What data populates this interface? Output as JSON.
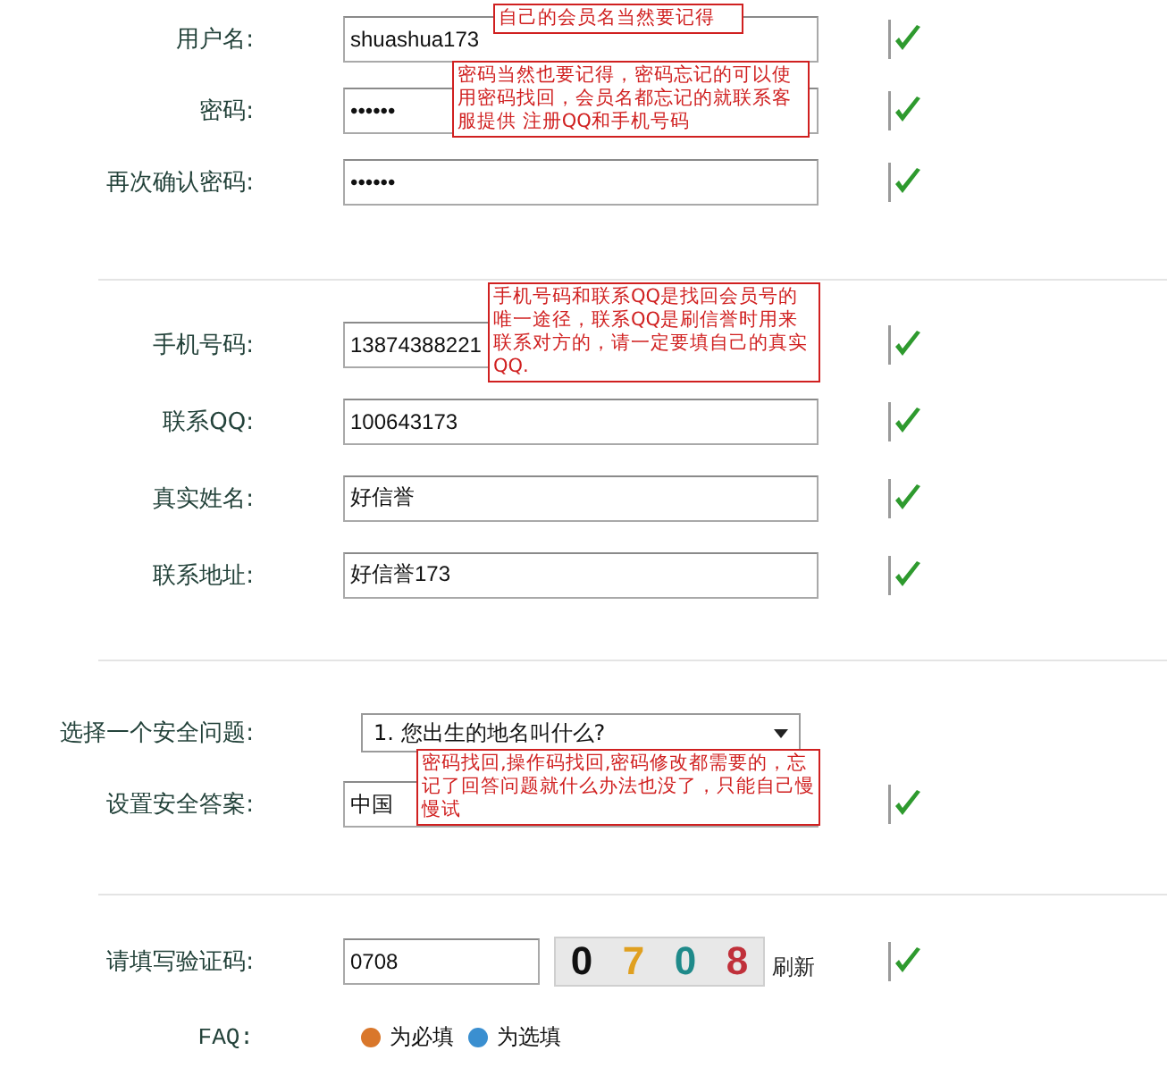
{
  "sections": [
    {
      "rows": [
        {
          "kind": "input",
          "label": "用户名:",
          "value": "shuashua173",
          "valid": true,
          "note": "自己的会员名当然要记得"
        },
        {
          "kind": "input",
          "label": "密码:",
          "value": "••••••",
          "valid": true,
          "note": "密码当然也要记得，密码忘记的可以使用密码找回，会员名都忘记的就联系客服提供 注册QQ和手机号码"
        },
        {
          "kind": "input",
          "label": "再次确认密码:",
          "value": "••••••",
          "valid": true
        }
      ]
    },
    {
      "rows": [
        {
          "kind": "input",
          "label": "手机号码:",
          "value": "13874388221",
          "valid": true,
          "note": "手机号码和联系QQ是找回会员号的唯一途径，联系QQ是刷信誉时用来联系对方的，请一定要填自己的真实QQ."
        },
        {
          "kind": "input",
          "label": "联系QQ:",
          "value": "100643173",
          "valid": true
        },
        {
          "kind": "input",
          "label": "真实姓名:",
          "value": "好信誉",
          "valid": true
        },
        {
          "kind": "input",
          "label": "联系地址:",
          "value": "好信誉173",
          "valid": true
        }
      ]
    },
    {
      "rows": [
        {
          "kind": "select",
          "label": "选择一个安全问题:",
          "value": "1. 您出生的地名叫什么?",
          "valid": false
        },
        {
          "kind": "input",
          "label": "设置安全答案:",
          "value": "中国",
          "valid": true,
          "note": "密码找回,操作码找回,密码修改都需要的，忘记了回答问题就什么办法也没了，只能自己慢慢试"
        }
      ]
    },
    {
      "rows": [
        {
          "kind": "captcha",
          "label": "请填写验证码:",
          "value": "0708",
          "valid": true,
          "captcha": [
            {
              "char": "0",
              "color": "#111111"
            },
            {
              "char": "7",
              "color": "#e0a020"
            },
            {
              "char": "0",
              "color": "#1f8a8a"
            },
            {
              "char": "8",
              "color": "#c0303a"
            }
          ],
          "refresh": "刷新"
        },
        {
          "kind": "legend",
          "label": "FAQ:",
          "items": [
            {
              "text": "为必填",
              "color": "#d9772b"
            },
            {
              "text": "为选填",
              "color": "#3a8fd0"
            }
          ]
        }
      ]
    }
  ]
}
